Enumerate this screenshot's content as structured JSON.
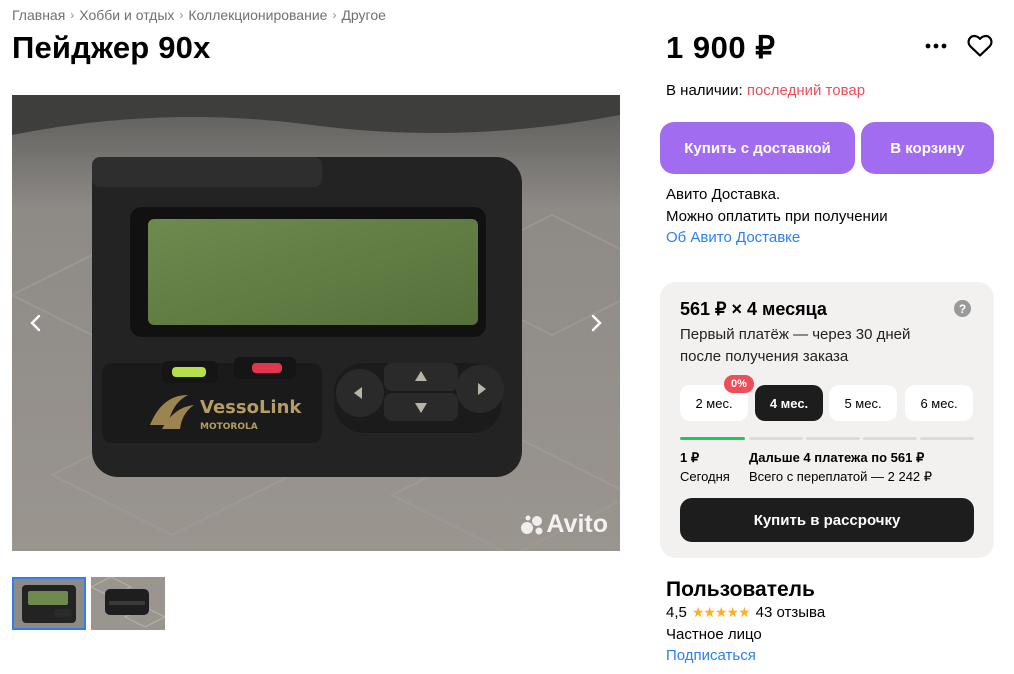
{
  "breadcrumb": [
    "Главная",
    "Хобби и отдых",
    "Коллекционирование",
    "Другое"
  ],
  "title": "Пейджер 90х",
  "price": "1 900 ₽",
  "availability": {
    "label": "В наличии:",
    "value": "последний товар"
  },
  "buttons": {
    "buy_delivery": "Купить с доставкой",
    "to_cart": "В корзину"
  },
  "delivery": {
    "line1": "Авито Доставка.",
    "line2": "Можно оплатить при получении",
    "link": "Об Авито Доставке"
  },
  "gallery": {
    "screen_brand": "VessoLink",
    "screen_brand_sub": "MOTOROLA",
    "watermark": "Avito"
  },
  "installment": {
    "headline": "561 ₽ × 4 месяца",
    "help": "?",
    "description": "Первый платёж — через 30 дней после получения заказа",
    "terms": [
      "2 мес.",
      "4 мес.",
      "5 мес.",
      "6 мес."
    ],
    "selected_term": "4 мес.",
    "badge": "0%",
    "first_amount": "1 ₽",
    "first_when": "Сегодня",
    "next_payments": "Дальше 4 платежа по 561 ₽",
    "total": "Всего с переплатой — 2 242 ₽",
    "buy_button": "Купить в рассрочку"
  },
  "seller": {
    "name": "Пользователь",
    "rating": "4,5",
    "reviews": "43 отзыва",
    "type": "Частное лицо",
    "subscribe": "Подписаться"
  },
  "colors": {
    "accent": "#a16cf0",
    "link": "#2d80f0",
    "alert": "#f04d5a",
    "success": "#1ec85a",
    "star": "#ffb021"
  }
}
